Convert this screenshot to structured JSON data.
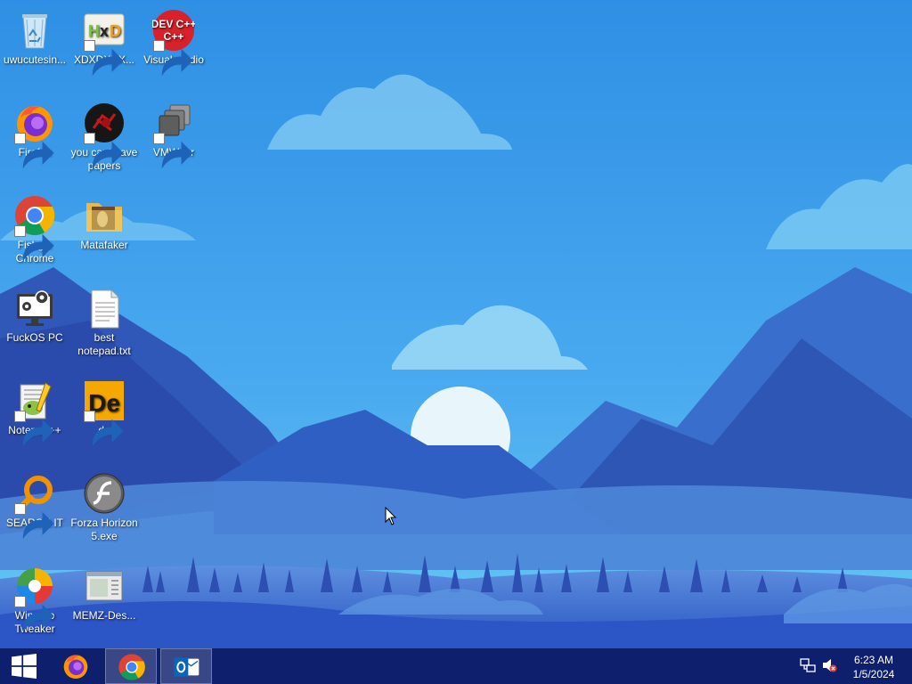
{
  "desktop": {
    "icons": [
      {
        "label": "uwucutesin...",
        "icon": "recycle-bin-icon"
      },
      {
        "label": "XDXDXDX...",
        "icon": "hxd-icon"
      },
      {
        "label": "Visual studio",
        "icon": "dev-cpp-icon",
        "badge_text": "DEV C++"
      },
      {
        "label": "Firefox",
        "icon": "firefox-icon"
      },
      {
        "label": "you cant have papers",
        "icon": "papers-icon"
      },
      {
        "label": "VMWaer",
        "icon": "vmware-icon"
      },
      {
        "label": "Fishgle Chrome",
        "icon": "chrome-icon"
      },
      {
        "label": "Matafaker",
        "icon": "folder-icon"
      },
      {
        "label": "FuckOS PC",
        "icon": "computer-icon"
      },
      {
        "label": "best notepad.txt",
        "icon": "text-file-icon"
      },
      {
        "label": "Notepad++",
        "icon": "notepad-plus-plus-icon"
      },
      {
        "label": "de",
        "icon": "de-icon",
        "badge_text": "De"
      },
      {
        "label": "SEARCH IT",
        "icon": "search-it-icon"
      },
      {
        "label": "Forza Horizon 5.exe",
        "icon": "flash-icon"
      },
      {
        "label": "Winaero Tweaker",
        "icon": "winaero-icon"
      },
      {
        "label": "MEMZ-Des...",
        "icon": "memz-icon"
      }
    ]
  },
  "taskbar": {
    "start": {
      "icon": "windows-logo-icon"
    },
    "pinned": [
      {
        "name": "Firefox",
        "icon": "firefox-icon",
        "active": false
      },
      {
        "name": "Chrome",
        "icon": "chrome-icon",
        "active": true
      },
      {
        "name": "Outlook",
        "icon": "outlook-icon",
        "active": true
      }
    ],
    "tray": {
      "network_icon": "network-icon",
      "volume_icon": "volume-muted-icon",
      "time": "6:23 AM",
      "date": "1/5/2024"
    }
  },
  "colors": {
    "taskbar": "#0e1f6d",
    "sky_top": "#2f8fe4",
    "sky_bottom": "#67c9f2"
  }
}
